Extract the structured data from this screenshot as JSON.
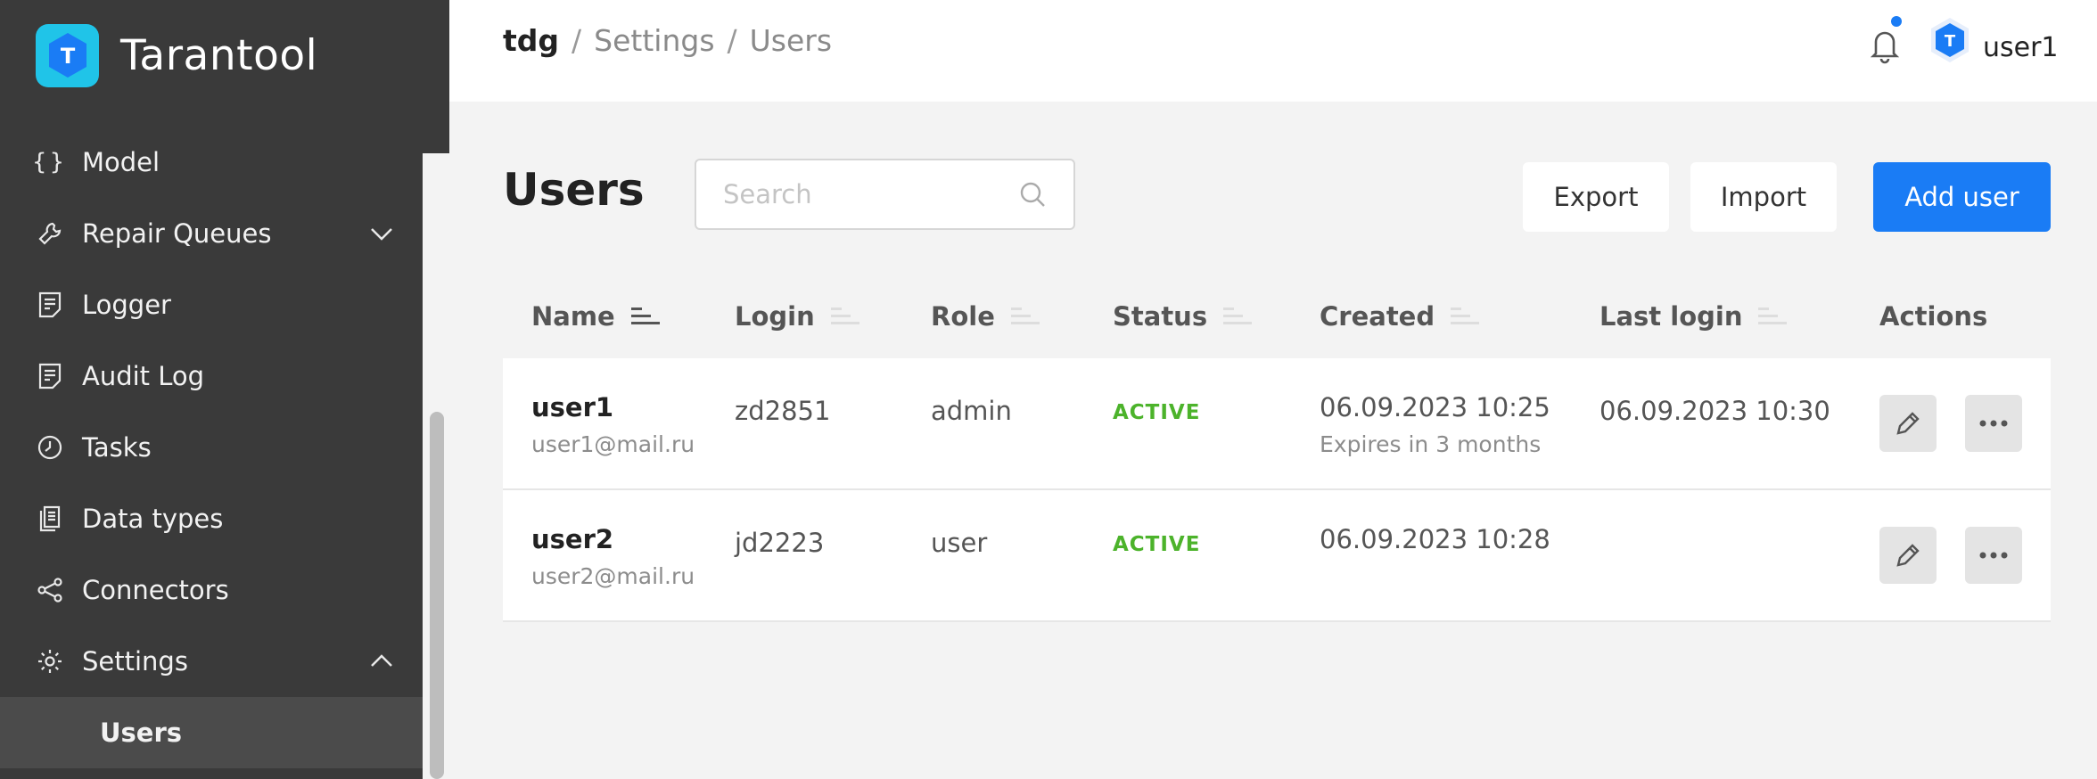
{
  "brand": {
    "name": "Tarantool",
    "mark_letter": "T",
    "accent": "#1a7cf5",
    "logo_bg": "#20c4e8"
  },
  "sidebar": {
    "items": [
      {
        "label": "Model",
        "icon": "braces-icon"
      },
      {
        "label": "Repair Queues",
        "icon": "wrench-icon",
        "expandable": true,
        "expanded": false
      },
      {
        "label": "Logger",
        "icon": "document-icon"
      },
      {
        "label": "Audit Log",
        "icon": "document-icon"
      },
      {
        "label": "Tasks",
        "icon": "clock-icon"
      },
      {
        "label": "Data types",
        "icon": "files-icon"
      },
      {
        "label": "Connectors",
        "icon": "share-icon"
      },
      {
        "label": "Settings",
        "icon": "gear-icon",
        "expandable": true,
        "expanded": true
      }
    ],
    "sub_items": [
      {
        "label": "Users",
        "active": true
      }
    ]
  },
  "header": {
    "breadcrumb": {
      "root": "tdg",
      "items": [
        "Settings",
        "Users"
      ],
      "separator": "/"
    },
    "user": {
      "name": "user1",
      "avatar_letter": "T"
    },
    "notifications_unread": true
  },
  "main": {
    "title": "Users",
    "search": {
      "placeholder": "Search",
      "value": ""
    },
    "buttons": {
      "export": "Export",
      "import": "Import",
      "add": "Add user"
    }
  },
  "table": {
    "columns": [
      "Name",
      "Login",
      "Role",
      "Status",
      "Created",
      "Last login",
      "Actions"
    ],
    "active_sort_column": "Name",
    "rows": [
      {
        "name": "user1",
        "email": "user1@mail.ru",
        "login": "zd2851",
        "role": "admin",
        "status": "ACTIVE",
        "created": "06.09.2023 10:25",
        "created_note": "Expires in 3 months",
        "last_login": "06.09.2023 10:30"
      },
      {
        "name": "user2",
        "email": "user2@mail.ru",
        "login": "jd2223",
        "role": "user",
        "status": "ACTIVE",
        "created": "06.09.2023 10:28",
        "created_note": "",
        "last_login": ""
      }
    ]
  }
}
